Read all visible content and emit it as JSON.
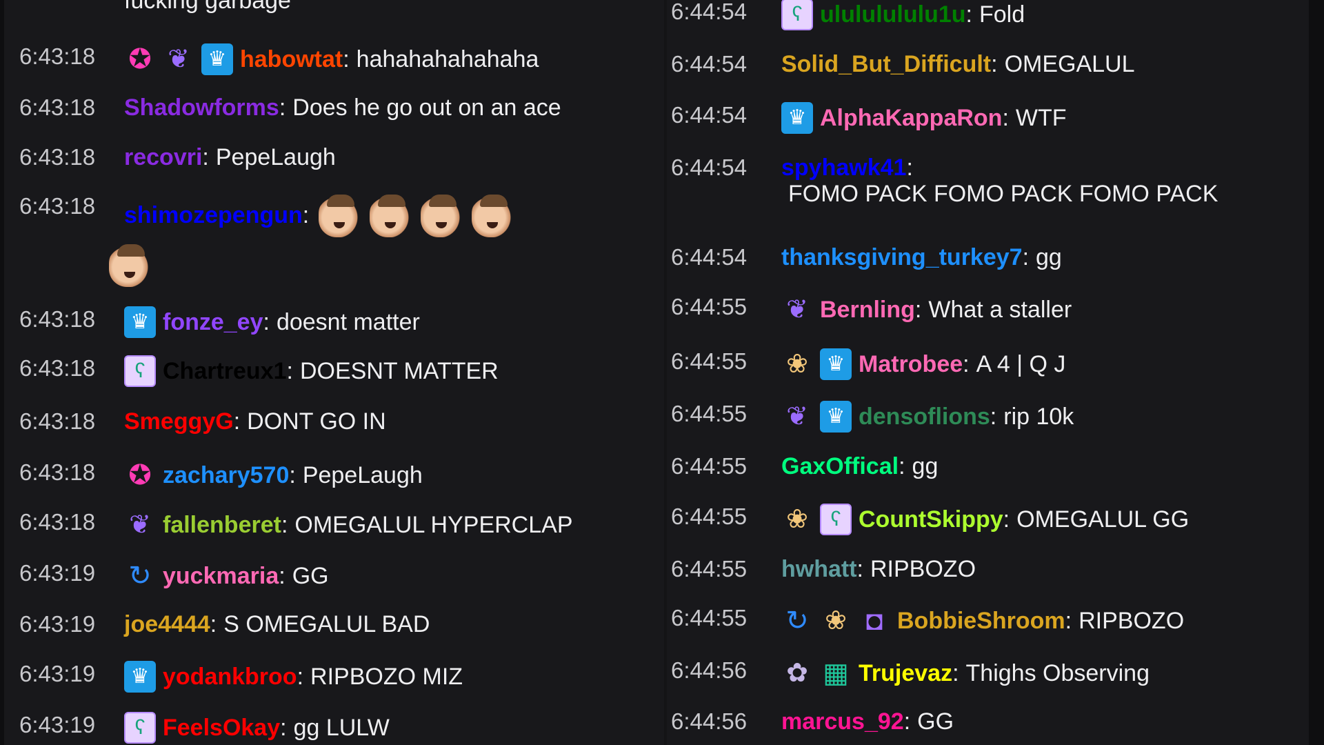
{
  "left_column": [
    {
      "time": "",
      "badges": [],
      "user": "",
      "user_color": "#efeff1",
      "text": "fucking garbage",
      "emotes": 0
    },
    {
      "time": "6:43:18",
      "badges": [
        "star-badge-icon",
        "bird-badge-icon",
        "crown-badge-icon"
      ],
      "user": "habowtat",
      "user_color": "#ff4500",
      "text": "hahahahahahaha",
      "emotes": 0
    },
    {
      "time": "6:43:18",
      "badges": [],
      "user": "Shadowforms",
      "user_color": "#8a2be2",
      "text": "Does he go out on an ace",
      "emotes": 0
    },
    {
      "time": "6:43:18",
      "badges": [],
      "user": "recovri",
      "user_color": "#8a2be2",
      "text": "PepeLaugh",
      "emotes": 0
    },
    {
      "time": "6:43:18",
      "badges": [],
      "user": "shimozepengun",
      "user_color": "#0000ff",
      "text": "",
      "emotes": 5
    },
    {
      "time": "6:43:18",
      "badges": [
        "crown-badge-icon"
      ],
      "user": "fonze_ey",
      "user_color": "#9146ff",
      "text": "doesnt matter",
      "emotes": 0
    },
    {
      "time": "6:43:18",
      "badges": [
        "sub-badge-icon"
      ],
      "user": "Chartreux1",
      "user_color": "#000000",
      "text": "DOESNT MATTER",
      "emotes": 0
    },
    {
      "time": "6:43:18",
      "badges": [],
      "user": "SmeggyG",
      "user_color": "#ff0000",
      "text": "DONT GO IN",
      "emotes": 0
    },
    {
      "time": "6:43:18",
      "badges": [
        "star-badge-icon"
      ],
      "user": "zachary570",
      "user_color": "#1e90ff",
      "text": "PepeLaugh",
      "emotes": 0
    },
    {
      "time": "6:43:18",
      "badges": [
        "bird-badge-icon"
      ],
      "user": "fallenberet",
      "user_color": "#9acd32",
      "text": "OMEGALUL HYPERCLAP",
      "emotes": 0
    },
    {
      "time": "6:43:19",
      "badges": [
        "loop-badge-icon"
      ],
      "user": "yuckmaria",
      "user_color": "#ff69b4",
      "text": "GG",
      "emotes": 0
    },
    {
      "time": "6:43:19",
      "badges": [],
      "user": "joe4444",
      "user_color": "#daa520",
      "text": "S OMEGALUL BAD",
      "emotes": 0
    },
    {
      "time": "6:43:19",
      "badges": [
        "crown-badge-icon"
      ],
      "user": "yodankbroo",
      "user_color": "#ff0000",
      "text": "RIPBOZO MIZ",
      "emotes": 0
    },
    {
      "time": "6:43:19",
      "badges": [
        "sub-badge-icon"
      ],
      "user": "FeelsOkay",
      "user_color": "#ff0000",
      "text": "gg LULW",
      "emotes": 0
    }
  ],
  "right_column": [
    {
      "time": "6:44:54",
      "badges": [
        "sub-badge-icon"
      ],
      "user": "ulululululu1u",
      "user_color": "#008000",
      "text": "Fold"
    },
    {
      "time": "6:44:54",
      "badges": [],
      "user": "Solid_But_Difficult",
      "user_color": "#daa520",
      "text": "OMEGALUL"
    },
    {
      "time": "6:44:54",
      "badges": [
        "crown-badge-icon"
      ],
      "user": "AlphaKappaRon",
      "user_color": "#ff69b4",
      "text": "WTF"
    },
    {
      "time": "6:44:54",
      "badges": [],
      "user": "spyhawk41",
      "user_color": "#0000ff",
      "text": "FOMO PACK FOMO PACK FOMO PACK"
    },
    {
      "time": "6:44:54",
      "badges": [],
      "user": "thanksgiving_turkey7",
      "user_color": "#1e90ff",
      "text": "gg"
    },
    {
      "time": "6:44:55",
      "badges": [
        "bird-badge-icon"
      ],
      "user": "Bernling",
      "user_color": "#ff69b4",
      "text": "What a staller"
    },
    {
      "time": "6:44:55",
      "badges": [
        "cow-badge-icon",
        "crown-badge-icon"
      ],
      "user": "Matrobee",
      "user_color": "#ff69b4",
      "text": "A 4 | Q J"
    },
    {
      "time": "6:44:55",
      "badges": [
        "bird-badge-icon",
        "crown-badge-icon"
      ],
      "user": "densoflions",
      "user_color": "#2e8b57",
      "text": "rip 10k"
    },
    {
      "time": "6:44:55",
      "badges": [],
      "user": "GaxOffical",
      "user_color": "#00ff7f",
      "text": "gg"
    },
    {
      "time": "6:44:55",
      "badges": [
        "cow-badge-icon",
        "sub-badge-icon"
      ],
      "user": "CountSkippy",
      "user_color": "#adff2f",
      "text": "OMEGALUL GG"
    },
    {
      "time": "6:44:55",
      "badges": [],
      "user": "hwhatt",
      "user_color": "#5f9ea0",
      "text": "RIPBOZO"
    },
    {
      "time": "6:44:55",
      "badges": [
        "loop-badge-icon",
        "cow-badge-icon",
        "frame-badge-icon"
      ],
      "user": "BobbieShroom",
      "user_color": "#daa520",
      "text": "RIPBOZO"
    },
    {
      "time": "6:44:56",
      "badges": [
        "owl-badge-icon",
        "gift-badge-icon"
      ],
      "user": "Trujevaz",
      "user_color": "#ffff00",
      "text": "Thighs Observing"
    },
    {
      "time": "6:44:56",
      "badges": [],
      "user": "marcus_92",
      "user_color": "#ff1493",
      "text": "GG"
    }
  ],
  "badge_glyphs": {
    "crown-badge-icon": "♛",
    "sub-badge-icon": "ʕ",
    "star-badge-icon": "✪",
    "bird-badge-icon": "❦",
    "cow-badge-icon": "❀",
    "loop-badge-icon": "↻",
    "gift-badge-icon": "▦",
    "frame-badge-icon": "◘",
    "owl-badge-icon": "✿"
  }
}
